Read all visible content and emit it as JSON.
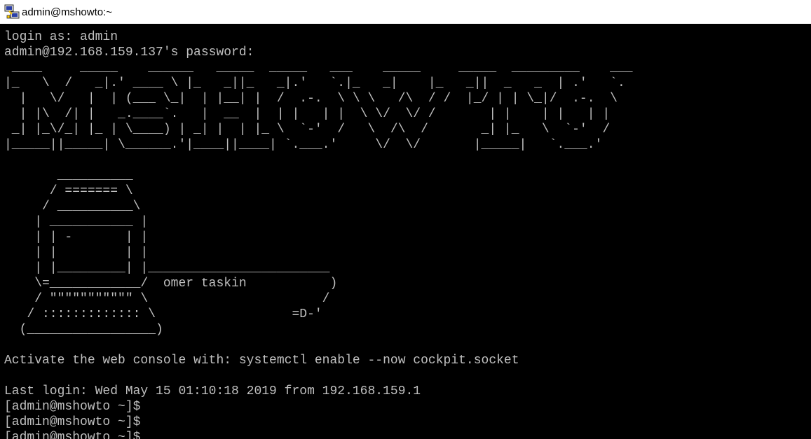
{
  "window": {
    "title": "admin@mshowto:~",
    "icon": "putty-icon"
  },
  "terminal": {
    "text_color": "#c0c0c0",
    "background_color": "#000000",
    "lines": [
      "login as: admin",
      "admin@192.168.159.137's password:",
      " ____     _____    ______   _____  _____   ___    _____     _____  _________    ___",
      "|_   \\  /   _|.' ____ \\ |_   _||_   _|.'   `.|_   _|    |_   _||  _   _  | .'   `.",
      "  |   \\/   |  | (___ \\_|  | |__| |  /  .-.  \\ \\ \\   /\\  / /  |_/ | | \\_|/  .-.  \\",
      "  | |\\  /| |   _.____`.   |  __  |  | |   | |  \\ \\/  \\/ /       | |    | |   | |",
      " _| |_\\/_| |_ | \\____) | _| |  | |_ \\  `-'  /   \\  /\\  /       _| |_   \\  `-'  /",
      "|_____||_____| \\______.'|____||____| `.___.'     \\/  \\/       |_____|   `.___.'",
      "",
      "       __________",
      "      / ======= \\",
      "     / __________\\",
      "    | ___________ |",
      "    | | -       | |",
      "    | |         | |",
      "    | |_________| |________________________",
      "    \\=____________/  omer taskin           )",
      "    / \"\"\"\"\"\"\"\"\"\"\" \\                       /",
      "   / ::::::::::::: \\                  =D-'",
      "  (_________________)",
      "",
      "Activate the web console with: systemctl enable --now cockpit.socket",
      "",
      "Last login: Wed May 15 01:10:18 2019 from 192.168.159.1",
      "[admin@mshowto ~]$",
      "[admin@mshowto ~]$",
      "[admin@mshowto ~]$"
    ]
  }
}
